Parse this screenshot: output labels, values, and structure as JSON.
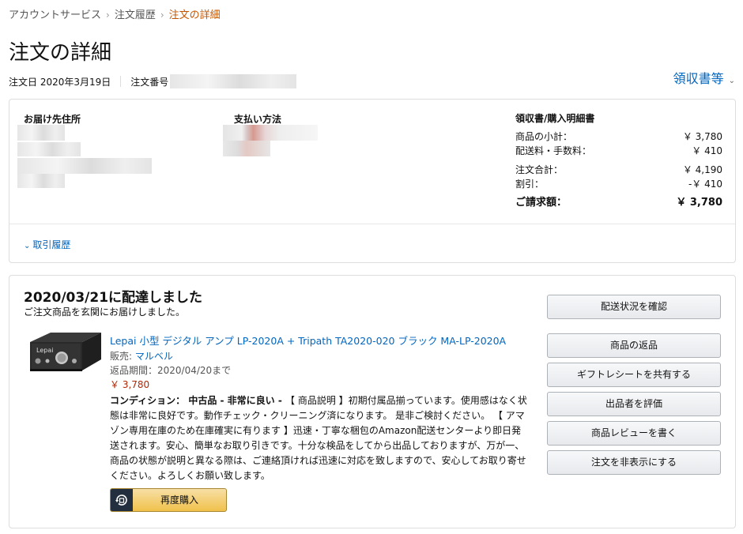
{
  "breadcrumb": {
    "items": [
      "アカウントサービス",
      "注文履歴"
    ],
    "current": "注文の詳細",
    "separator": "›"
  },
  "page_title": "注文の詳細",
  "order_meta": {
    "order_date": "注文日 2020年3月19日",
    "order_number_label": "注文番号"
  },
  "receipt_menu": {
    "label": "領収書等",
    "icon": "chevron-down-icon"
  },
  "order_info": {
    "shipping_title": "お届け先住所",
    "payment_title": "支払い方法",
    "summary_title": "領収書/購入明細書",
    "summary_rows": [
      {
        "label": "商品の小計：",
        "value": "￥ 3,780"
      },
      {
        "label": "配送料・手数料：",
        "value": "￥ 410"
      }
    ],
    "summary_rows2": [
      {
        "label": "注文合計：",
        "value": "￥ 4,190"
      },
      {
        "label": "割引：",
        "value": "-￥ 410"
      }
    ],
    "total": {
      "label": "ご請求額：",
      "value": "￥ 3,780"
    },
    "history_link": "取引履歴"
  },
  "shipment": {
    "status": "2020/03/21に配達しました",
    "status_sub": "ご注文商品を玄関にお届けしました。",
    "product": {
      "title": "Lepai 小型 デジタル アンプ LP-2020A + Tripath TA2020-020 ブラック MA-LP-2020A",
      "seller_label": "販売: ",
      "seller_name": "マルベル",
      "return_period": "返品期間：2020/04/20まで",
      "price": "￥ 3,780",
      "condition_label": "コンディション： 中古品 - 非常に良い - ",
      "condition_text": "【 商品説明 】初期付属品揃っています。使用感はなく状態は非常に良好です。動作チェック・クリーニング済になります。 是非ご検討ください。 【 アマゾン専用在庫のため在庫確実に有ります 】迅速・丁寧な梱包のAmazon配送センターより即日発送されます。安心、簡単なお取り引きです。十分な検品をしてから出品しておりますが、万が一、商品の状態が説明と異なる際は、ご連絡頂ければ迅速に対応を致しますので、安心してお取り寄せください。よろしくお願い致します。"
    },
    "buy_again_label": "再度購入",
    "actions": [
      "配送状況を確認",
      "商品の返品",
      "ギフトレシートを共有する",
      "出品者を評価",
      "商品レビューを書く",
      "注文を非表示にする"
    ]
  },
  "colors": {
    "link": "#0066c0",
    "breadcrumb_current": "#c45500",
    "price": "#b12704",
    "buy_again": "#f0c14b"
  }
}
